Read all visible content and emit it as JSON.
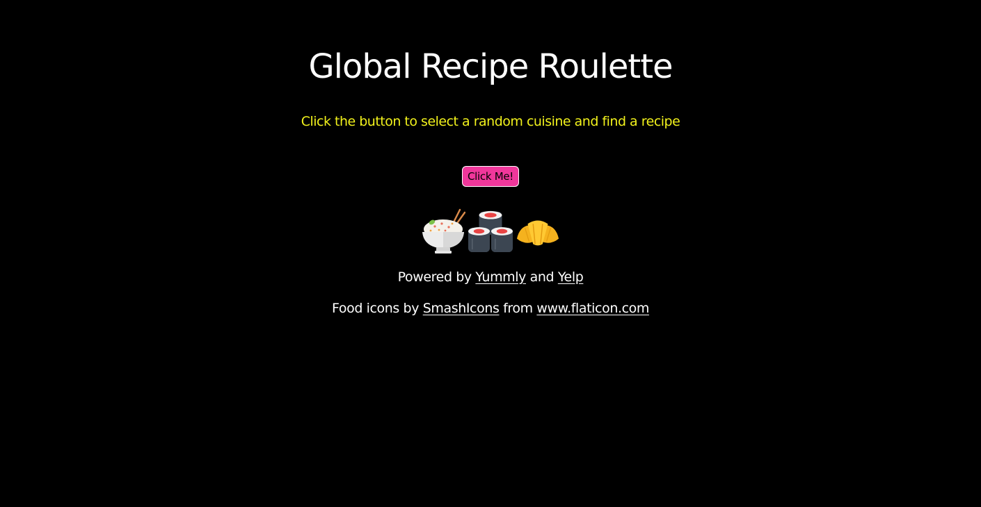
{
  "header": {
    "title": "Global Recipe Roulette",
    "subtitle": "Click the button to select a random cuisine and find a recipe"
  },
  "action": {
    "button_label": "Click Me!"
  },
  "icons": [
    "rice-bowl-icon",
    "sushi-icon",
    "croissant-icon"
  ],
  "credits": {
    "powered_prefix": "Powered by ",
    "yummly": "Yummly",
    "and": " and ",
    "yelp": "Yelp",
    "icons_prefix": "Food icons by ",
    "smashicons": "SmashIcons",
    "from": " from ",
    "flaticon": "www.flaticon.com"
  },
  "colors": {
    "background": "#000000",
    "subtitle": "#f2f21c",
    "button": "#f0379b"
  }
}
